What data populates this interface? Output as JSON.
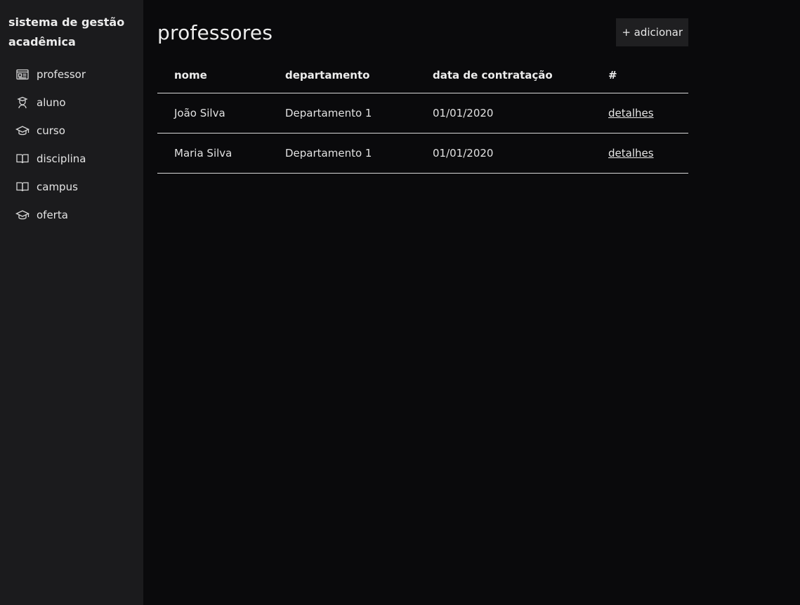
{
  "sidebar": {
    "title": "sistema de gestão acadêmica",
    "items": [
      {
        "label": "professor",
        "icon": "id-card-icon"
      },
      {
        "label": "aluno",
        "icon": "student-icon"
      },
      {
        "label": "curso",
        "icon": "graduation-cap-icon"
      },
      {
        "label": "disciplina",
        "icon": "book-icon"
      },
      {
        "label": "campus",
        "icon": "book-icon"
      },
      {
        "label": "oferta",
        "icon": "graduation-cap-icon"
      }
    ]
  },
  "main": {
    "title": "professores",
    "add_label": "+ adicionar",
    "table": {
      "headers": [
        "nome",
        "departamento",
        "data de contratação",
        "#"
      ],
      "rows": [
        {
          "nome": "João Silva",
          "departamento": "Departamento 1",
          "data": "01/01/2020",
          "action": "detalhes"
        },
        {
          "nome": "Maria Silva",
          "departamento": "Departamento 1",
          "data": "01/01/2020",
          "action": "detalhes"
        }
      ]
    }
  },
  "colors": {
    "background": "#0a0a0c",
    "sidebar": "#1b1b1d",
    "button": "#1f1f21",
    "divider": "#d8d8d8"
  }
}
